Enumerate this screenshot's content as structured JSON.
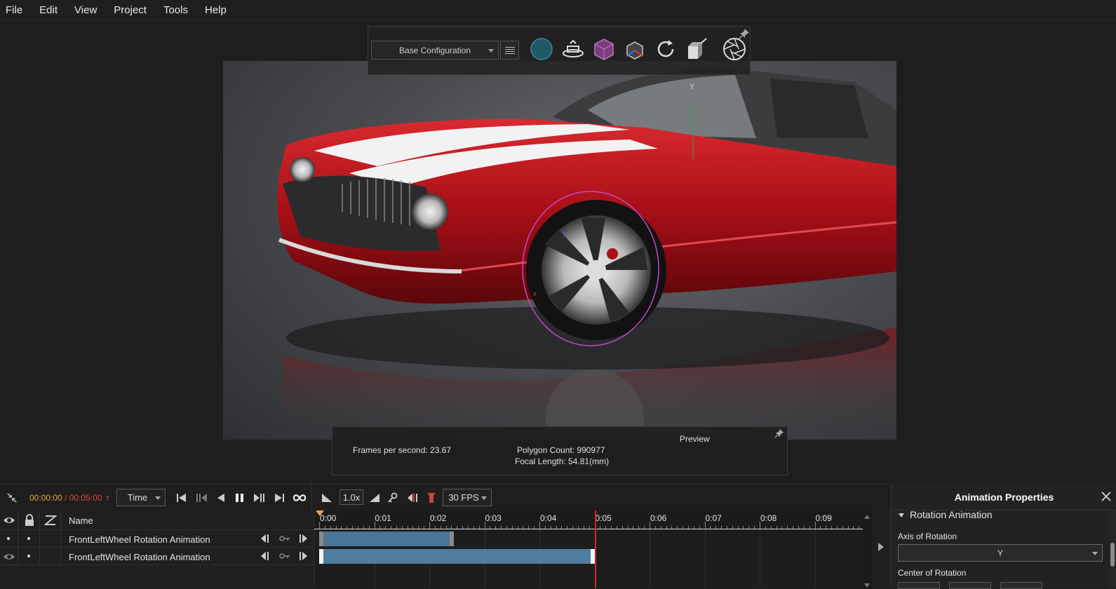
{
  "menu": {
    "items": [
      "File",
      "Edit",
      "View",
      "Project",
      "Tools",
      "Help"
    ]
  },
  "toolbar": {
    "configuration": "Base Configuration",
    "icons": [
      "environment-sphere-icon",
      "turntable-icon",
      "material-cube-icon",
      "scene-cube-icon",
      "rotate-refresh-icon",
      "camera-view-icon",
      "aperture-icon",
      "pin-icon"
    ]
  },
  "viewport": {
    "axis_label": "Y",
    "gizmo_labels": {
      "x": "x",
      "z": "z"
    }
  },
  "preview": {
    "title": "Preview",
    "fps_text": "Frames per second: 23.67",
    "polygon_text": "Polygon Count: 990977",
    "focal_text": "Focal Length: 54.81(mm)"
  },
  "timeline": {
    "current_time": "00:00:00",
    "separator": " / ",
    "total_time": "00:05:00",
    "time_mark": "T",
    "mode": "Time",
    "speed": "1.0x",
    "fps_select": "30 FPS",
    "name_header": "Name",
    "tracks": [
      {
        "name": "FrontLeftWheel Rotation Animation",
        "start": 0.0,
        "end": 2.45
      },
      {
        "name": "FrontLeftWheel Rotation Animation",
        "start": 0.0,
        "end": 5.0
      }
    ],
    "ruler_labels": [
      "0:00",
      "0:01",
      "0:02",
      "0:03",
      "0:04",
      "0:05",
      "0:06",
      "0:07",
      "0:08",
      "0:09"
    ],
    "playhead_time": 5.0
  },
  "properties": {
    "title": "Animation Properties",
    "section": "Rotation Animation",
    "axis_label": "Axis of Rotation",
    "axis_value": "Y",
    "center_label": "Center of Rotation"
  },
  "colors": {
    "clip": "#4a7597",
    "playhead": "#d9261c",
    "time_current": "#e8a33a",
    "time_total": "#d9443a",
    "car_red": "#b3121a"
  }
}
